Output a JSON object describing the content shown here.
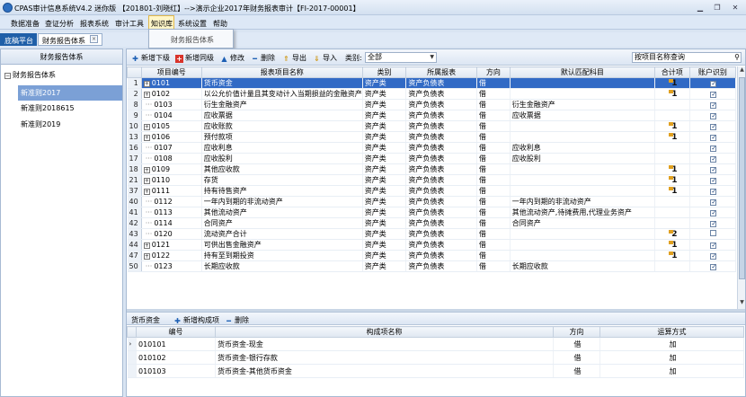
{
  "window": {
    "title": "CPAS审计信息系统V4.2 迷你版 【201801-刘晓红】-->演示企业2017年财务报表审计【FI-2017-00001】"
  },
  "menu": [
    "数据准备",
    "查证分析",
    "报表系统",
    "审计工具",
    "知识库",
    "系统设置",
    "帮助"
  ],
  "dropdown": {
    "item": "财务报告体系"
  },
  "tabs": {
    "platform": "底稿平台",
    "finsys": "财务报告体系",
    "close": "×"
  },
  "tree": {
    "header": "财务报告体系",
    "root": "财务报告体系",
    "nodes": [
      "新准则2017",
      "新准则2018615",
      "新准则2019"
    ]
  },
  "toolbar": {
    "add_child": "新增下级",
    "add_sibling": "新增同级",
    "edit": "修改",
    "delete": "删除",
    "export": "导出",
    "import": "导入",
    "category_label": "类别:",
    "category_value": "全部",
    "search_placeholder": "按项目名称查询"
  },
  "grid": {
    "columns": [
      "项目编号",
      "报表项目名称",
      "类别",
      "所属报表",
      "方向",
      "默认匹配科目",
      "合计项",
      "账户识别"
    ],
    "rows": [
      {
        "rn": "1",
        "code": "0101",
        "expand": true,
        "name": "货币资金",
        "cat": "资产类",
        "report": "资产负债表",
        "dir": "借",
        "match": "",
        "total": "1",
        "badge": true,
        "acct": true,
        "sel": true
      },
      {
        "rn": "2",
        "code": "0102",
        "expand": true,
        "name": "以公允价值计量且其变动计入当期损益的金融资产",
        "cat": "资产类",
        "report": "资产负债表",
        "dir": "借",
        "match": "",
        "total": "1",
        "badge": true,
        "acct": true
      },
      {
        "rn": "8",
        "code": "0103",
        "expand": false,
        "name": "衍生金融资产",
        "cat": "资产类",
        "report": "资产负债表",
        "dir": "借",
        "match": "衍生金融资产",
        "total": "",
        "badge": false,
        "acct": true
      },
      {
        "rn": "9",
        "code": "0104",
        "expand": false,
        "name": "应收票据",
        "cat": "资产类",
        "report": "资产负债表",
        "dir": "借",
        "match": "应收票据",
        "total": "",
        "badge": false,
        "acct": true
      },
      {
        "rn": "10",
        "code": "0105",
        "expand": true,
        "name": "应收账款",
        "cat": "资产类",
        "report": "资产负债表",
        "dir": "借",
        "match": "",
        "total": "1",
        "badge": true,
        "acct": true
      },
      {
        "rn": "13",
        "code": "0106",
        "expand": true,
        "name": "预付款项",
        "cat": "资产类",
        "report": "资产负债表",
        "dir": "借",
        "match": "",
        "total": "1",
        "badge": true,
        "acct": true
      },
      {
        "rn": "16",
        "code": "0107",
        "expand": false,
        "name": "应收利息",
        "cat": "资产类",
        "report": "资产负债表",
        "dir": "借",
        "match": "应收利息",
        "total": "",
        "badge": false,
        "acct": true
      },
      {
        "rn": "17",
        "code": "0108",
        "expand": false,
        "name": "应收股利",
        "cat": "资产类",
        "report": "资产负债表",
        "dir": "借",
        "match": "应收股利",
        "total": "",
        "badge": false,
        "acct": true
      },
      {
        "rn": "18",
        "code": "0109",
        "expand": true,
        "name": "其他应收款",
        "cat": "资产类",
        "report": "资产负债表",
        "dir": "借",
        "match": "",
        "total": "1",
        "badge": true,
        "acct": true
      },
      {
        "rn": "21",
        "code": "0110",
        "expand": true,
        "name": "存货",
        "cat": "资产类",
        "report": "资产负债表",
        "dir": "借",
        "match": "",
        "total": "1",
        "badge": true,
        "acct": true
      },
      {
        "rn": "37",
        "code": "0111",
        "expand": true,
        "name": "持有待售资产",
        "cat": "资产类",
        "report": "资产负债表",
        "dir": "借",
        "match": "",
        "total": "1",
        "badge": true,
        "acct": true
      },
      {
        "rn": "40",
        "code": "0112",
        "expand": false,
        "name": "一年内到期的非流动资产",
        "cat": "资产类",
        "report": "资产负债表",
        "dir": "借",
        "match": "一年内到期的非流动资产",
        "total": "",
        "badge": false,
        "acct": true
      },
      {
        "rn": "41",
        "code": "0113",
        "expand": false,
        "name": "其他流动资产",
        "cat": "资产类",
        "report": "资产负债表",
        "dir": "借",
        "match": "其他流动资产,待摊费用,代理业务资产",
        "total": "",
        "badge": false,
        "acct": true
      },
      {
        "rn": "42",
        "code": "0114",
        "expand": false,
        "name": "合同资产",
        "cat": "资产类",
        "report": "资产负债表",
        "dir": "借",
        "match": "合同资产",
        "total": "",
        "badge": false,
        "acct": true
      },
      {
        "rn": "43",
        "code": "0120",
        "expand": false,
        "name": "流动资产合计",
        "cat": "资产类",
        "report": "资产负债表",
        "dir": "借",
        "match": "",
        "total": "2",
        "badge": true,
        "acct": false
      },
      {
        "rn": "44",
        "code": "0121",
        "expand": true,
        "name": "可供出售金融资产",
        "cat": "资产类",
        "report": "资产负债表",
        "dir": "借",
        "match": "",
        "total": "1",
        "badge": true,
        "acct": true
      },
      {
        "rn": "47",
        "code": "0122",
        "expand": true,
        "name": "持有至到期投资",
        "cat": "资产类",
        "report": "资产负债表",
        "dir": "借",
        "match": "",
        "total": "1",
        "badge": true,
        "acct": true
      },
      {
        "rn": "50",
        "code": "0123",
        "expand": false,
        "name": "长期应收款",
        "cat": "资产类",
        "report": "资产负债表",
        "dir": "借",
        "match": "长期应收款",
        "total": "",
        "badge": false,
        "acct": true
      }
    ]
  },
  "bottom": {
    "title": "货币资金",
    "add": "新增构成项",
    "delete": "删除",
    "columns": [
      "编号",
      "构成项名称",
      "方向",
      "运算方式"
    ],
    "rows": [
      {
        "code": "010101",
        "name": "货币资金-现金",
        "dir": "借",
        "op": "加"
      },
      {
        "code": "010102",
        "name": "货币资金-银行存款",
        "dir": "借",
        "op": "加"
      },
      {
        "code": "010103",
        "name": "货币资金-其他货币资金",
        "dir": "借",
        "op": "加"
      }
    ]
  }
}
